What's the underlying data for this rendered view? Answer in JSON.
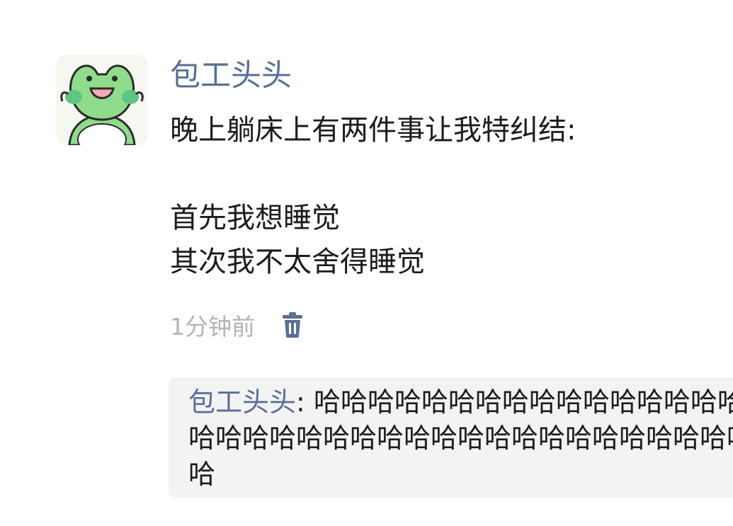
{
  "post": {
    "author": "包工头头",
    "lines": [
      "晚上躺床上有两件事让我特纠结:",
      "",
      "首先我想睡觉",
      "其次我不太舍得睡觉"
    ],
    "time": "1分钟前",
    "delete_icon": "trash-icon"
  },
  "comments": [
    {
      "author": "包工头头",
      "separator": ": ",
      "text": "哈哈哈哈哈哈哈哈哈哈哈哈哈哈哈哈哈哈哈哈哈哈哈哈哈哈哈哈哈哈哈哈哈哈哈哈哈哈哈哈哈哈"
    }
  ],
  "colors": {
    "author": "#5a6f94",
    "body_text": "#1c1c1c",
    "timestamp": "#b4b4b4",
    "comment_bg": "#f3f3f4",
    "avatar_green": "#8fdc8c"
  }
}
